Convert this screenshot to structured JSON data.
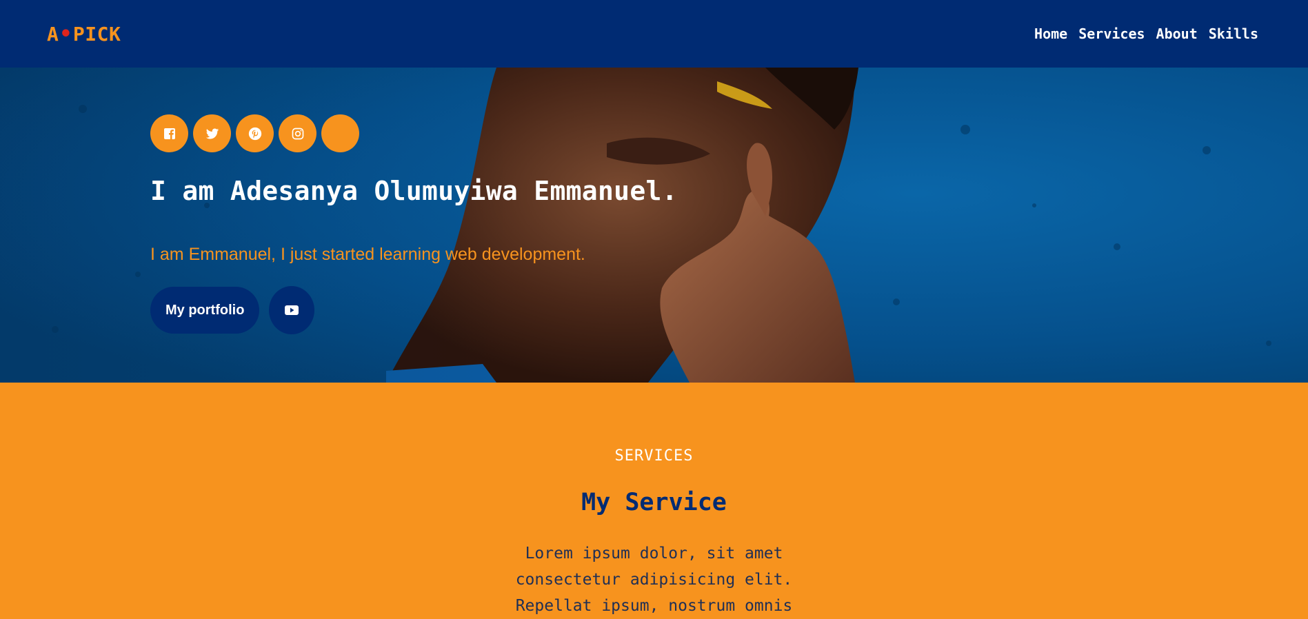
{
  "brand": {
    "prefix": "A",
    "dot": "•",
    "suffix": "PICK"
  },
  "nav": {
    "links": [
      "Home",
      "Services",
      "About",
      "Skills"
    ]
  },
  "hero": {
    "social_icons": [
      "facebook-icon",
      "twitter-icon",
      "pinterest-icon",
      "instagram-icon",
      "empty-social-icon"
    ],
    "title": "I am Adesanya Olumuyiwa Emmanuel.",
    "subtitle": "I am Emmanuel, I just started learning web development.",
    "portfolio_label": "My portfolio",
    "video_icon": "youtube-icon"
  },
  "services": {
    "eyebrow": "SERVICES",
    "title": "My Service",
    "text": "Lorem ipsum dolor, sit amet consectetur adipisicing elit. Repellat ipsum, nostrum omnis"
  },
  "colors": {
    "navy": "#002b73",
    "orange": "#f7931e",
    "accent_red": "#e0241c",
    "hero_blue": "#06508c"
  }
}
